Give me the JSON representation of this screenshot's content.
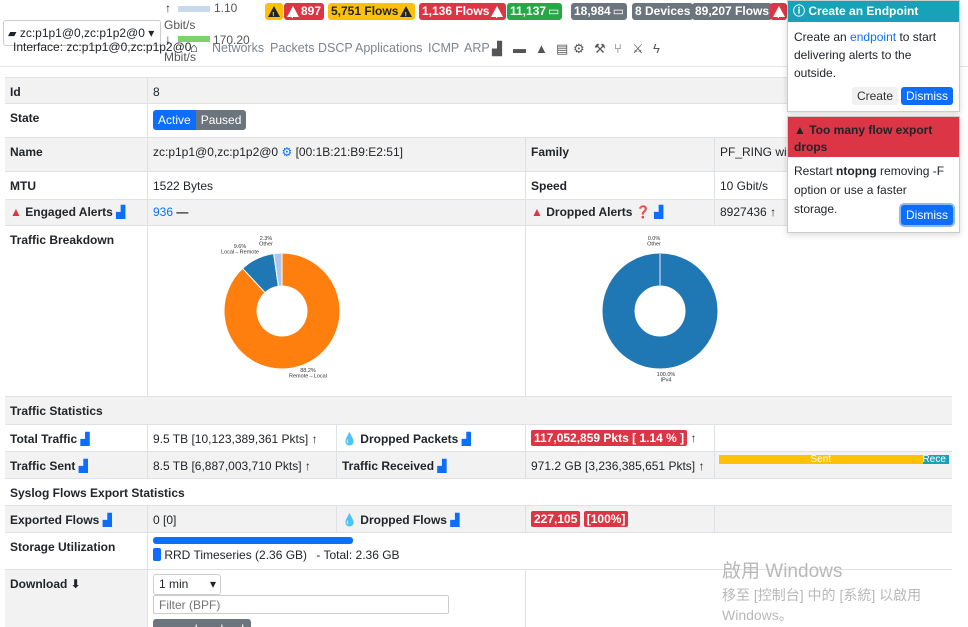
{
  "header": {
    "interface_selector": "zc:p1p1@0,zc:p1p2@0",
    "interface_label": "Interface: zc:p1p1@0,zc:p1p2@0",
    "upload_speed": "1.10",
    "upload_unit": "Gbit/s",
    "download_speed": "170.20",
    "download_unit": "Mbit/s",
    "badges": [
      {
        "text": "",
        "style": "warn"
      },
      {
        "text": "897",
        "style": "red"
      },
      {
        "text": "5,751 Flows",
        "style": "warn"
      },
      {
        "text": "1,136 Flows",
        "style": "red"
      },
      {
        "text": "11,137",
        "style": "green"
      },
      {
        "text": "18,984",
        "style": "gray"
      },
      {
        "text": "8 Devices",
        "style": "gray"
      },
      {
        "text": "89,207 Flows",
        "style": "gray"
      }
    ],
    "nav": [
      "Networks",
      "Packets",
      "DSCP",
      "Applications",
      "ICMP",
      "ARP"
    ]
  },
  "details": {
    "id_label": "Id",
    "id_value": "8",
    "state_label": "State",
    "state_active": "Active",
    "state_paused": "Paused",
    "name_label": "Name",
    "name_value": "zc:p1p1@0,zc:p1p2@0",
    "mac": "[00:1B:21:B9:E2:51]",
    "family_label": "Family",
    "family_value": "PF_RING with",
    "mtu_label": "MTU",
    "mtu_value": "1522 Bytes",
    "speed_label": "Speed",
    "speed_value": "10 Gbit/s",
    "engaged_label": "Engaged Alerts",
    "engaged_value": "936",
    "dropped_alerts_label": "Dropped Alerts",
    "dropped_alerts_value": "8927436",
    "breakdown_label": "Traffic Breakdown"
  },
  "chart_data": [
    {
      "type": "pie",
      "categories": [
        "Remote→Local",
        "Local→Remote",
        "Other"
      ],
      "values": [
        88.2,
        9.6,
        2.3
      ],
      "colors": [
        "#ff7f0e",
        "#1f77b4",
        "#aec7e8"
      ],
      "labels": [
        "88.2%",
        "9.6%",
        "2.3%"
      ]
    },
    {
      "type": "pie",
      "categories": [
        "IPv4",
        "Other"
      ],
      "values": [
        100.0,
        0.0
      ],
      "colors": [
        "#1f77b4",
        "#aec7e8"
      ],
      "labels": [
        "100.0%",
        "0.0%"
      ]
    }
  ],
  "stats": {
    "section_label": "Traffic Statistics",
    "total_traffic_label": "Total Traffic",
    "total_traffic_value": "9.5 TB [10,123,389,361 Pkts]",
    "dropped_packets_label": "Dropped Packets",
    "dropped_packets_value": "117,052,859 Pkts [ 1.14 % ]",
    "traffic_sent_label": "Traffic Sent",
    "traffic_sent_value": "8.5 TB [6,887,003,710 Pkts]",
    "traffic_received_label": "Traffic Received",
    "traffic_received_value": "971.2 GB [3,236,385,651 Pkts]",
    "bar_sent": "Sent",
    "bar_recv": "Rece",
    "sent_fraction": 0.885
  },
  "syslog": {
    "section_label": "Syslog Flows Export Statistics",
    "exported_label": "Exported Flows",
    "exported_value": "0 [0]",
    "dropped_flows_label": "Dropped Flows",
    "dropped_flows_value": "227,105",
    "dropped_flows_pct": "[100%]"
  },
  "storage": {
    "label": "Storage Utilization",
    "legend": "RRD Timeseries (2.36 GB)",
    "total": "-  Total: 2.36 GB"
  },
  "download": {
    "label": "Download",
    "duration": "1 min",
    "filter_placeholder": "Filter (BPF)",
    "button": "pcap download"
  },
  "toasts": {
    "endpoint_title": "Create an Endpoint",
    "endpoint_pre": "Create an",
    "endpoint_link": "endpoint",
    "endpoint_post": "to start delivering alerts to the outside.",
    "create_btn": "Create",
    "dismiss_btn": "Dismiss",
    "drops_title": "Too many flow export drops",
    "drops_pre": "Restart",
    "drops_bold": "ntopng",
    "drops_post": "removing -F option or use a faster storage.",
    "dismiss_btn2": "Dismiss"
  },
  "watermark": {
    "line1": "啟用 Windows",
    "line2": "移至 [控制台] 中的 [系統] 以啟用",
    "line3": "Windows。"
  }
}
